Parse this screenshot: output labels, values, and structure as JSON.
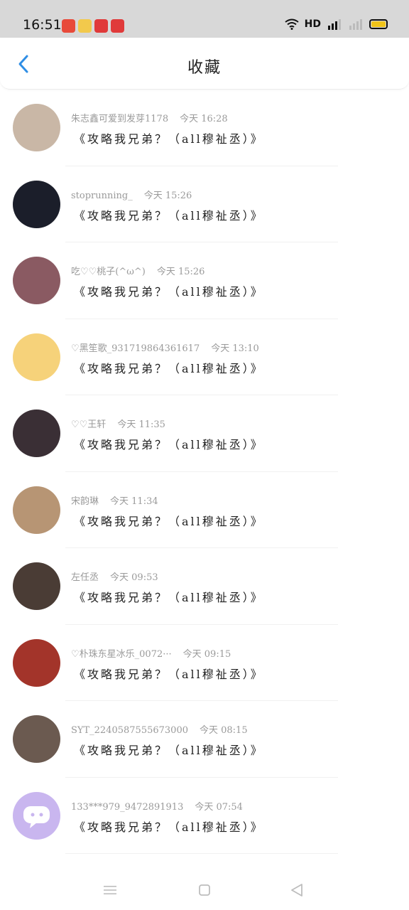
{
  "status_bar": {
    "time": "16:51",
    "network_label": "HD",
    "apps": [
      "app-icon-1",
      "app-icon-2",
      "app-icon-3",
      "app-icon-4"
    ]
  },
  "header": {
    "title": "收藏",
    "back_icon": "chevron-left-icon",
    "accent_color": "#2f8ee5"
  },
  "items": [
    {
      "username": "朱志鑫可爱到发芽1178",
      "time": "今天 16:28",
      "title": "《攻略我兄弟？（all穆祉丞）》",
      "avatar_color": "#c9b7a6"
    },
    {
      "username": "stoprunning_",
      "time": "今天 15:26",
      "title": "《攻略我兄弟？（all穆祉丞）》",
      "avatar_color": "#1b1e2a"
    },
    {
      "username": "吃♡♡桃子(^ω^)",
      "time": "今天 15:26",
      "title": "《攻略我兄弟？（all穆祉丞）》",
      "avatar_color": "#8a5a62"
    },
    {
      "username": "♡黑笙歌_931719864361617",
      "time": "今天 13:10",
      "title": "《攻略我兄弟？（all穆祉丞）》",
      "avatar_color": "#f6d27a"
    },
    {
      "username": "♡♡王轩",
      "time": "今天 11:35",
      "title": "《攻略我兄弟？（all穆祉丞）》",
      "avatar_color": "#3a2f35"
    },
    {
      "username": "宋韵琳",
      "time": "今天 11:34",
      "title": "《攻略我兄弟？（all穆祉丞）》",
      "avatar_color": "#b79574"
    },
    {
      "username": "左任丞",
      "time": "今天 09:53",
      "title": "《攻略我兄弟？（all穆祉丞）》",
      "avatar_color": "#4a3c35"
    },
    {
      "username": "♡朴珠东星冰乐_0072···",
      "time": "今天 09:15",
      "title": "《攻略我兄弟？（all穆祉丞）》",
      "avatar_color": "#a3342a"
    },
    {
      "username": "SYT_2240587555673000",
      "time": "今天 08:15",
      "title": "《攻略我兄弟？（all穆祉丞）》",
      "avatar_color": "#6b5a50"
    },
    {
      "username": "133***979_9472891913",
      "time": "今天 07:54",
      "title": "《攻略我兄弟？（all穆祉丞）》",
      "avatar_color": "#c9b6ef"
    }
  ],
  "nav_bar": {
    "icons": [
      "menu-icon",
      "home-icon",
      "back-triangle-icon"
    ]
  }
}
